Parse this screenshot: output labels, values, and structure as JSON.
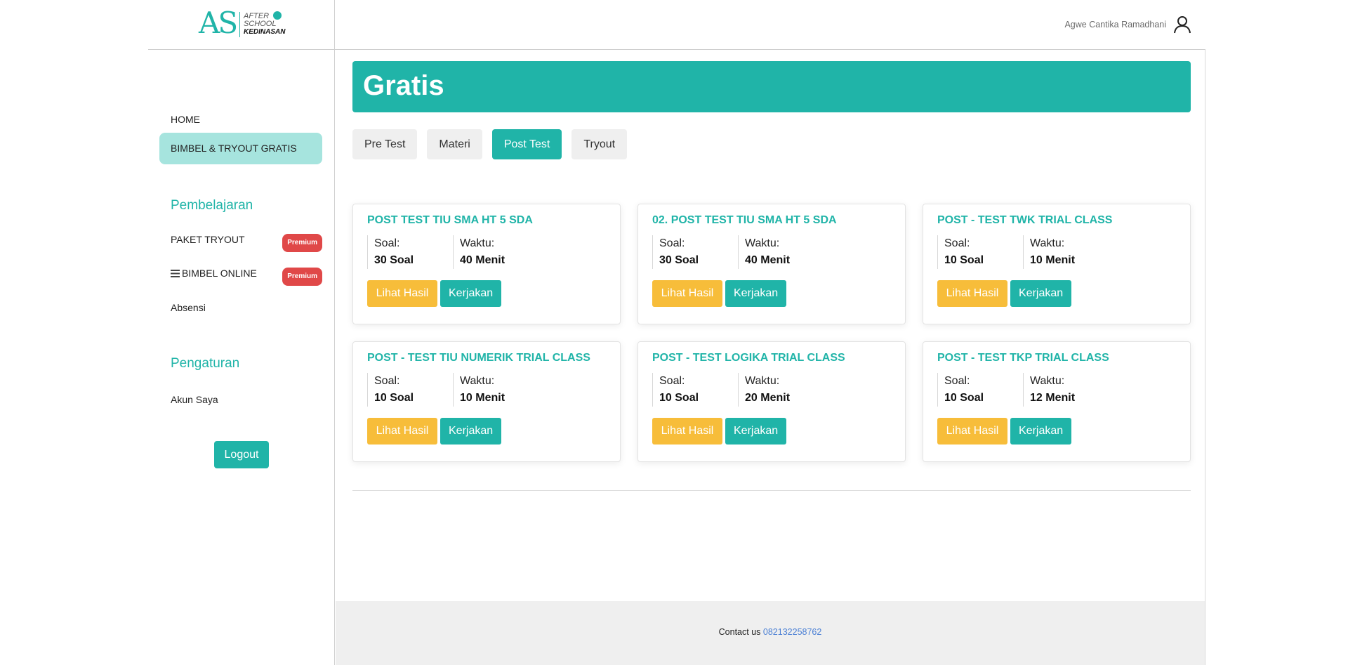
{
  "header": {
    "brand": {
      "letters": "AS",
      "line1": "AFTER",
      "line2": "SCHOOL",
      "line3": "KEDINASAN"
    },
    "user_name": "Agwe Cantika Ramadhani"
  },
  "sidebar": {
    "home": "HOME",
    "bimbel_tryout_gratis": "BIMBEL & TRYOUT GRATIS",
    "pembelajaran_title": "Pembelajaran",
    "paket_tryout": "PAKET TRYOUT",
    "bimbel_online": "BIMBEL ONLINE",
    "premium_badge": "Premium",
    "absensi": "Absensi",
    "pengaturan_title": "Pengaturan",
    "akun_saya": "Akun Saya",
    "logout": "Logout"
  },
  "main": {
    "banner_title": "Gratis",
    "tabs": [
      {
        "label": "Pre Test"
      },
      {
        "label": "Materi"
      },
      {
        "label": "Post Test",
        "active": true
      },
      {
        "label": "Tryout"
      }
    ],
    "labels": {
      "soal": "Soal:",
      "waktu": "Waktu:",
      "lihat_hasil": "Lihat Hasil",
      "kerjakan": "Kerjakan"
    },
    "cards": [
      {
        "title": "POST TEST TIU SMA HT 5 SDA",
        "soal": "30 Soal",
        "waktu": "40 Menit"
      },
      {
        "title": "02. POST TEST TIU SMA HT 5 SDA",
        "soal": "30 Soal",
        "waktu": "40 Menit"
      },
      {
        "title": "POST - TEST TWK TRIAL CLASS",
        "soal": "10 Soal",
        "waktu": "10 Menit"
      },
      {
        "title": "POST - TEST TIU NUMERIK TRIAL CLASS",
        "soal": "10 Soal",
        "waktu": "10 Menit"
      },
      {
        "title": "POST - TEST LOGIKA TRIAL CLASS",
        "soal": "10 Soal",
        "waktu": "20 Menit"
      },
      {
        "title": "POST - TEST TKP TRIAL CLASS",
        "soal": "10 Soal",
        "waktu": "12 Menit"
      }
    ]
  },
  "footer": {
    "contact_label": "Contact us",
    "phone": "082132258762"
  },
  "colors": {
    "accent": "#20b4a8",
    "accent_light": "#a6e4de",
    "warning": "#f7bd3a",
    "badge": "#e04848",
    "link": "#4a7fd4"
  }
}
